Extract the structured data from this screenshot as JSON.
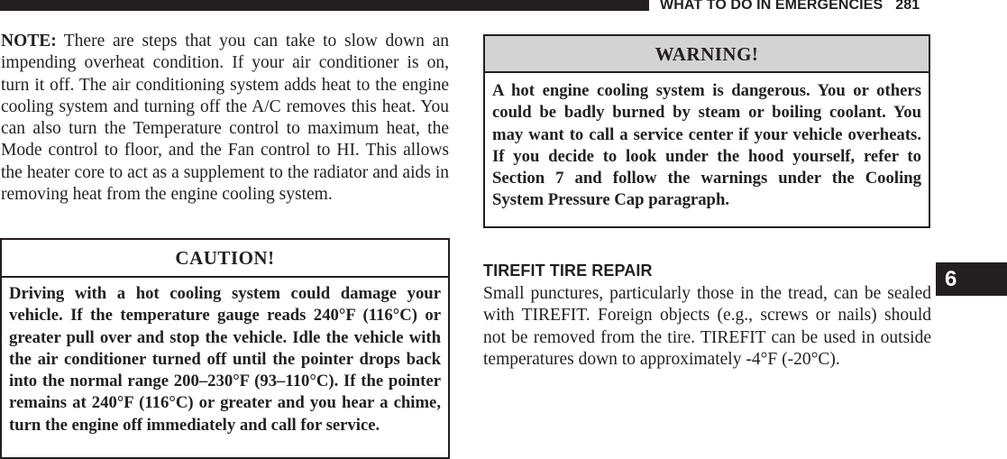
{
  "header": {
    "running_head": "WHAT TO DO IN EMERGENCIES",
    "page_number": "281"
  },
  "note": {
    "label": "NOTE:",
    "text": "There are steps that you can take to slow down an impending overheat condition. If your air conditioner is on, turn it off. The air conditioning system adds heat to the engine cooling system and turning off the A/C removes this heat. You can also turn the Temperature control to maximum heat, the Mode control to floor, and the Fan control to HI. This allows the heater core to act as a supplement to the radiator and aids in removing heat from the engine cooling system."
  },
  "caution": {
    "title": "CAUTION!",
    "text": "Driving with a hot cooling system could damage your vehicle. If the temperature gauge reads 240°F (116°C) or greater pull over and stop the vehicle. Idle the vehicle with the air conditioner turned off until the pointer drops back into the normal range 200–230°F (93–110°C). If the pointer remains at 240°F (116°C) or greater and you hear a chime, turn the engine off immediately and call for service."
  },
  "warning": {
    "title": "WARNING!",
    "text": "A hot engine cooling system is dangerous. You or others could be badly burned by steam or boiling coolant. You may want to call a service center if your vehicle overheats. If you decide to look under the hood yourself, refer to Section 7 and follow the warnings under the Cooling System Pressure Cap paragraph."
  },
  "tirefit": {
    "heading": "TIREFIT TIRE REPAIR",
    "text": "Small punctures, particularly those in the tread, can be sealed with TIREFIT. Foreign objects (e.g., screws or nails) should not be removed from the tire. TIREFIT can be used in outside temperatures down to approximately -4°F (-20°C)."
  },
  "section_tab": {
    "label": "6"
  }
}
